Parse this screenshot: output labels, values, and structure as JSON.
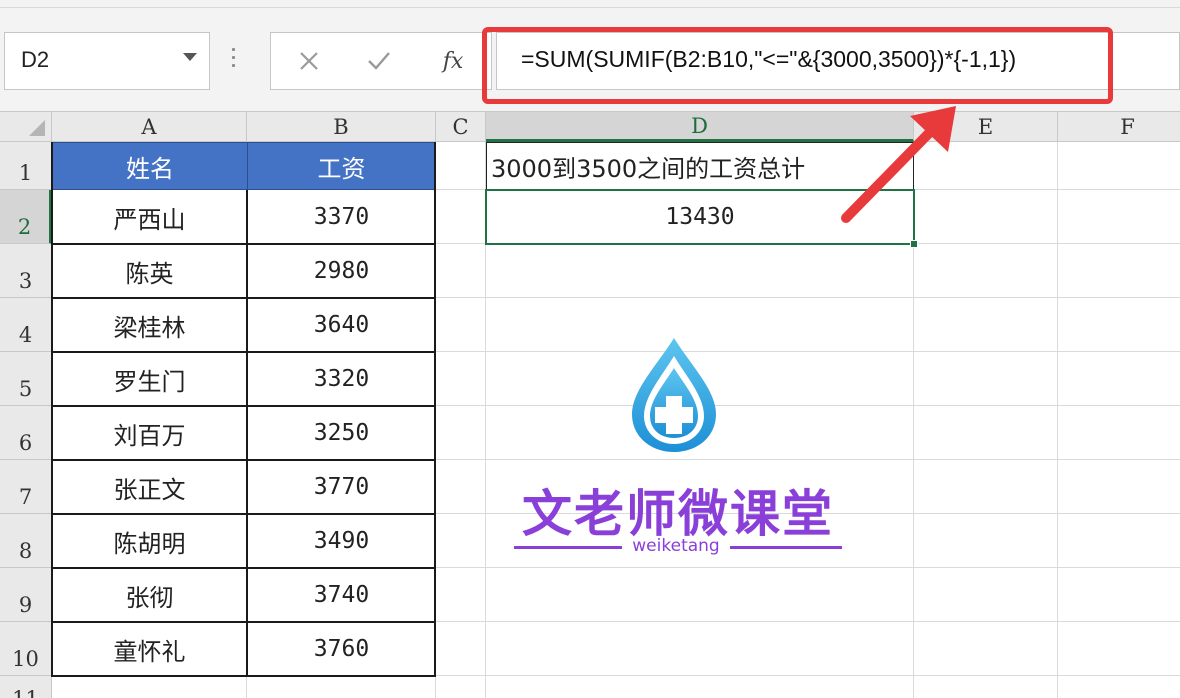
{
  "name_box": {
    "value": "D2"
  },
  "formula_bar": {
    "cancel_icon": "x-icon",
    "enter_icon": "check-icon",
    "fx_label": "fx",
    "formula": "=SUM(SUMIF(B2:B10,\"<=\"&{3000,3500})*{-1,1})"
  },
  "columns": [
    "A",
    "B",
    "C",
    "D",
    "E",
    "F"
  ],
  "active_column": "D",
  "rows": [
    "1",
    "2",
    "3",
    "4",
    "5",
    "6",
    "7",
    "8",
    "9",
    "10",
    "11"
  ],
  "active_row": "2",
  "table": {
    "headers": [
      "姓名",
      "工资"
    ],
    "rows": [
      [
        "严西山",
        "3370"
      ],
      [
        "陈英",
        "2980"
      ],
      [
        "梁桂林",
        "3640"
      ],
      [
        "罗生门",
        "3320"
      ],
      [
        "刘百万",
        "3250"
      ],
      [
        "张正文",
        "3770"
      ],
      [
        "陈胡明",
        "3490"
      ],
      [
        "张彻",
        "3740"
      ],
      [
        "童怀礼",
        "3760"
      ]
    ]
  },
  "d1_text": "3000到3500之间的工资总计",
  "d2_value": "13430",
  "watermark": {
    "title": "文老师微课堂",
    "subtitle": "weiketang"
  },
  "colors": {
    "header_fill": "#4472c4",
    "selection": "#217346",
    "highlight": "#e8393b",
    "watermark": "#8a3fd8"
  }
}
